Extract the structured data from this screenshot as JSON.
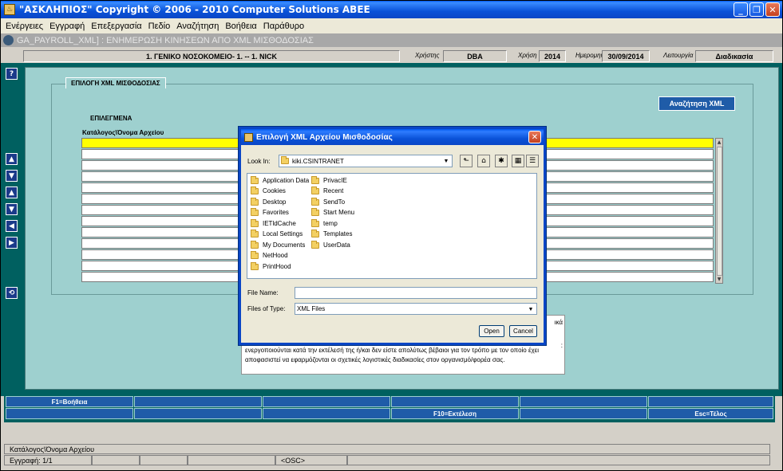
{
  "window": {
    "title": "\"ΑΣΚΛΗΠΙΟΣ\" Copyright © 2006 - 2010 Computer Solutions ABEE",
    "minimize": "_",
    "restore": "❐",
    "close": "✕"
  },
  "menu": [
    "Ενέργειες",
    "Εγγραφή",
    "Επεξεργασία",
    "Πεδίο",
    "Αναζήτηση",
    "Βοήθεια",
    "Παράθυρο"
  ],
  "form_title": "GA_PAYROLL_XML]  :  ΕΝΗΜΕΡΩΣΗ ΚΙΝΗΣΕΩΝ ΑΠΟ XML ΜΙΣΘΟΔΟΣΙΑΣ",
  "info": {
    "hospital": "1. ΓΕΝΙΚΟ ΝΟΣΟΚΟΜΕΙΟ- 1. -- 1. NICK",
    "user_label": "Χρήστης",
    "user": "DBA",
    "year_label": "Χρήση",
    "year": "2014",
    "date_label": "Ημερομηνία",
    "date": "30/09/2014",
    "function_label": "Λειτουργία",
    "function": "Διαδικασία"
  },
  "left_toolbar": [
    "?",
    "▲",
    "▼",
    "▲",
    "▼",
    "◀",
    "▶",
    "⟲"
  ],
  "form": {
    "tab_label": "ΕΠΙΛΟΓΗ XML ΜΙΣΘΟΔΟΣΙΑΣ",
    "search_button": "Αναζήτηση XML",
    "group_label": "ΕΠΙΛΕΓΜΕΝΑ",
    "column_label": "Κατάλογος\\Όνομα Αρχείου",
    "info_right1": "ικά",
    "info_right2": ":",
    "info_text": "ενεργοποιούνται κατά την εκτέλεσή της ή/και δεν είστε απολύτως βέβαιοι για τον τρόπο με τον οποίο έχει αποφασιστεί να εφαρμόζονται οι σχετικές λογιστικές διαδικασίες στον οργανισμό/φορέα σας."
  },
  "fkeys": {
    "row1": [
      "F1=Βοήθεια",
      "",
      "",
      "",
      "",
      ""
    ],
    "row2": [
      "",
      "",
      "",
      "F10=Εκτέλεση",
      "",
      "Esc=Τέλος"
    ]
  },
  "status": {
    "field": "Κατάλογος\\Όνομα Αρχείου",
    "record": "Εγγραφή: 1/1",
    "osc": "<OSC>"
  },
  "dialog": {
    "title": "Επιλογή XML Αρχείου Μισθοδοσίας",
    "look_in_label": "Look In:",
    "look_in_value": "kiki.CSINTRANET",
    "col1": [
      "Application Data",
      "Cookies",
      "Desktop",
      "Favorites",
      "IETldCache",
      "Local Settings",
      "My Documents",
      "NetHood",
      "PrintHood"
    ],
    "col2": [
      "PrivacIE",
      "Recent",
      "SendTo",
      "Start Menu",
      "temp",
      "Templates",
      "UserData"
    ],
    "file_name_label": "File Name:",
    "file_name_value": "",
    "files_of_type_label": "Files of Type:",
    "files_of_type_value": "XML Files",
    "open_button": "Open",
    "cancel_button": "Cancel"
  }
}
